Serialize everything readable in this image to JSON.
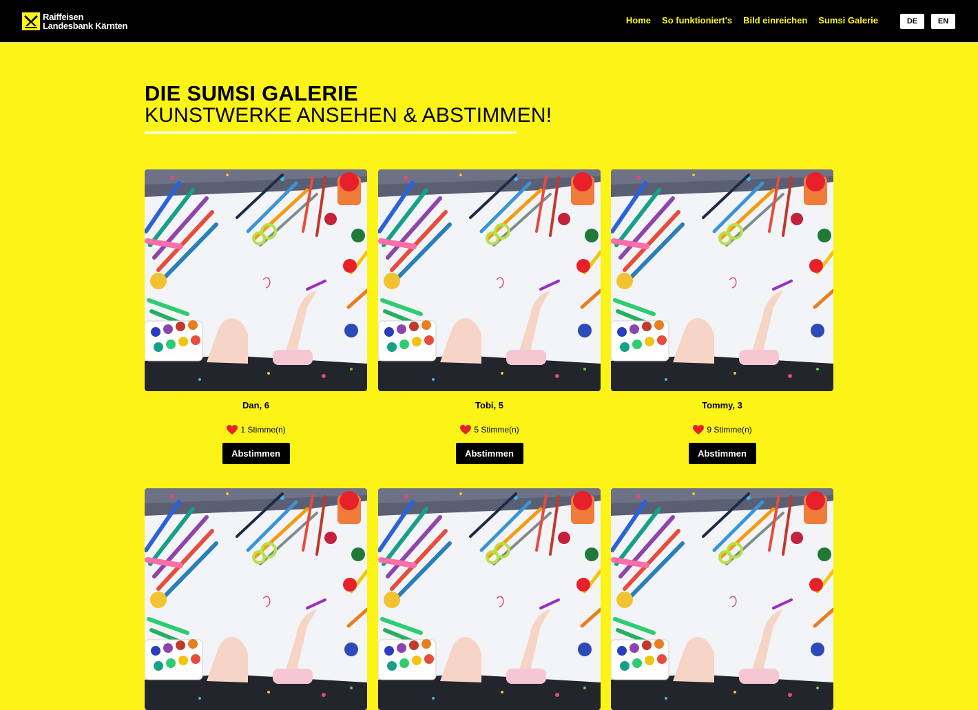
{
  "brand": {
    "line1": "Raiffeisen",
    "line2": "Landesbank Kärnten",
    "accent": "#fcf417"
  },
  "nav": {
    "items": [
      {
        "label": "Home"
      },
      {
        "label": "So funktioniert's"
      },
      {
        "label": "Bild einreichen"
      },
      {
        "label": "Sumsi Galerie"
      }
    ]
  },
  "lang": {
    "de": "DE",
    "en": "EN"
  },
  "page": {
    "title": "DIE SUMSI GALERIE",
    "subtitle": "KUNSTWERKE ANSEHEN & ABSTIMMEN!"
  },
  "gallery": {
    "vote_label": "Abstimmen",
    "heart_color": "#e8202a",
    "items": [
      {
        "name": "Dan, 6",
        "votes": "1 Stimme(n)"
      },
      {
        "name": "Tobi, 5",
        "votes": "5 Stimme(n)"
      },
      {
        "name": "Tommy, 3",
        "votes": "9 Stimme(n)"
      }
    ]
  }
}
